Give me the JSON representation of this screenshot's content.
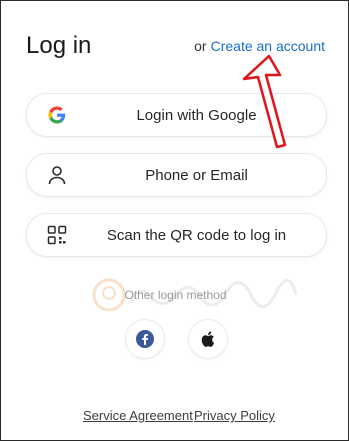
{
  "header": {
    "title": "Log in",
    "or_text": "or",
    "create_account_link": "Create an account"
  },
  "login_options": [
    {
      "label": "Login with Google",
      "icon": "google-icon"
    },
    {
      "label": "Phone or Email",
      "icon": "user-icon"
    },
    {
      "label": "Scan the QR code to log in",
      "icon": "qr-code-icon"
    }
  ],
  "other_login": {
    "label": "Other login method",
    "options": [
      {
        "icon": "facebook-icon",
        "color": "#3b5998"
      },
      {
        "icon": "apple-icon",
        "color": "#1a1a1a"
      }
    ]
  },
  "footer": {
    "service_agreement": "Service Agreement",
    "privacy_policy": "Privacy Policy"
  },
  "colors": {
    "link": "#1a6fc9",
    "annotation_arrow": "#e0141b",
    "facebook": "#3b5998"
  }
}
